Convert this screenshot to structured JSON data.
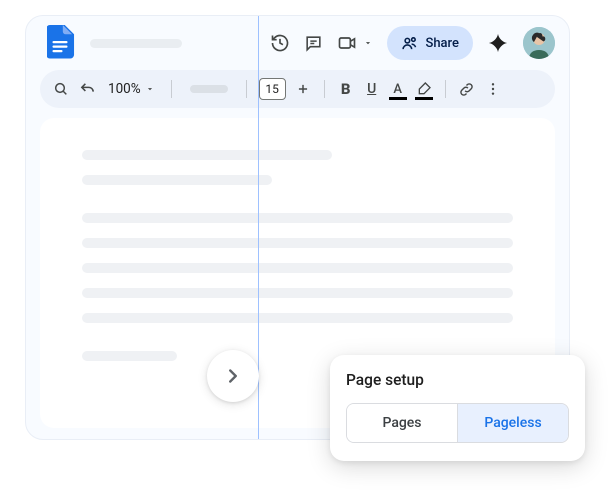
{
  "header": {
    "share_label": "Share"
  },
  "toolbar": {
    "zoom": "100%",
    "font_size": "15",
    "bold": "B",
    "underline": "U",
    "text_color": "A"
  },
  "popup": {
    "title": "Page setup",
    "pages_label": "Pages",
    "pageless_label": "Pageless"
  }
}
